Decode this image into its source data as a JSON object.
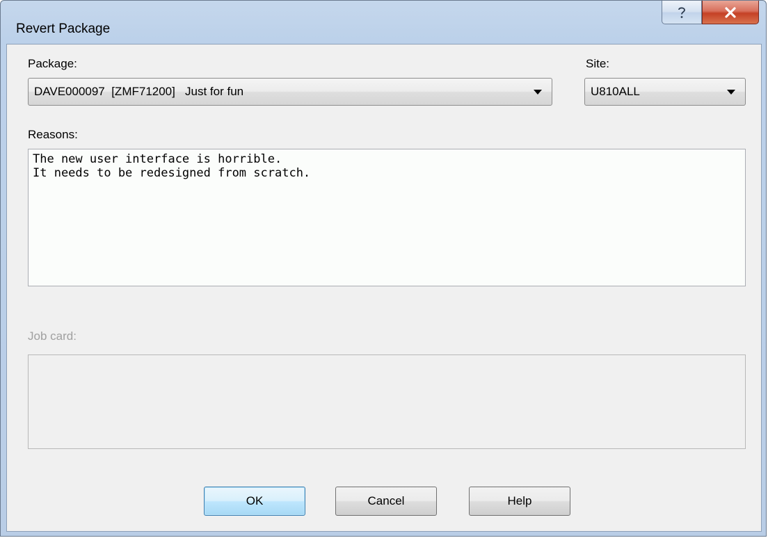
{
  "window": {
    "title": "Revert Package"
  },
  "titlebar_buttons": {
    "help_icon": "question-icon",
    "close_icon": "close-x-icon"
  },
  "package": {
    "label": "Package:",
    "value": "DAVE000097  [ZMF71200]   Just for fun"
  },
  "site": {
    "label": "Site:",
    "value": "U810ALL"
  },
  "reasons": {
    "label": "Reasons:",
    "text": "The new user interface is horrible.\nIt needs to be redesigned from scratch."
  },
  "job_card": {
    "label": "Job card:",
    "text": ""
  },
  "buttons": {
    "ok": "OK",
    "cancel": "Cancel",
    "help": "Help"
  },
  "colors": {
    "close_button": "#c54126",
    "default_button_border": "#3c7fb1",
    "disabled_text": "#a0a0a0"
  }
}
